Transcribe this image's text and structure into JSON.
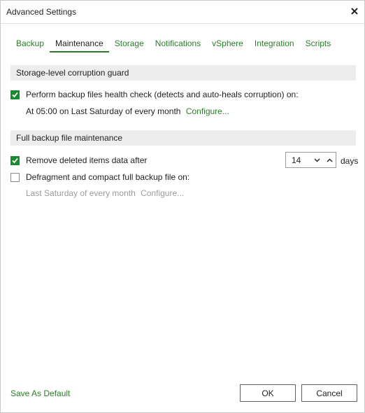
{
  "window": {
    "title": "Advanced Settings"
  },
  "tabs": [
    {
      "label": "Backup",
      "active": false
    },
    {
      "label": "Maintenance",
      "active": true
    },
    {
      "label": "Storage",
      "active": false
    },
    {
      "label": "Notifications",
      "active": false
    },
    {
      "label": "vSphere",
      "active": false
    },
    {
      "label": "Integration",
      "active": false
    },
    {
      "label": "Scripts",
      "active": false
    }
  ],
  "storage_guard": {
    "header": "Storage-level corruption guard",
    "health_check": {
      "label": "Perform backup files health check (detects and auto-heals corruption) on:",
      "checked": true,
      "schedule": "At 05:00 on Last Saturday of every month",
      "configure_link": "Configure..."
    }
  },
  "full_backup": {
    "header": "Full backup file maintenance",
    "remove_deleted": {
      "label": "Remove deleted items data after",
      "checked": true,
      "value": "14",
      "unit": "days"
    },
    "defragment": {
      "label": "Defragment and compact full backup file on:",
      "checked": false,
      "schedule": "Last Saturday of every month",
      "configure_link": "Configure..."
    }
  },
  "footer": {
    "save_default": "Save As Default",
    "ok": "OK",
    "cancel": "Cancel"
  },
  "colors": {
    "accent": "#2a7d2a",
    "checkbox": "#1a8a2f",
    "section_bg": "#ededed"
  }
}
